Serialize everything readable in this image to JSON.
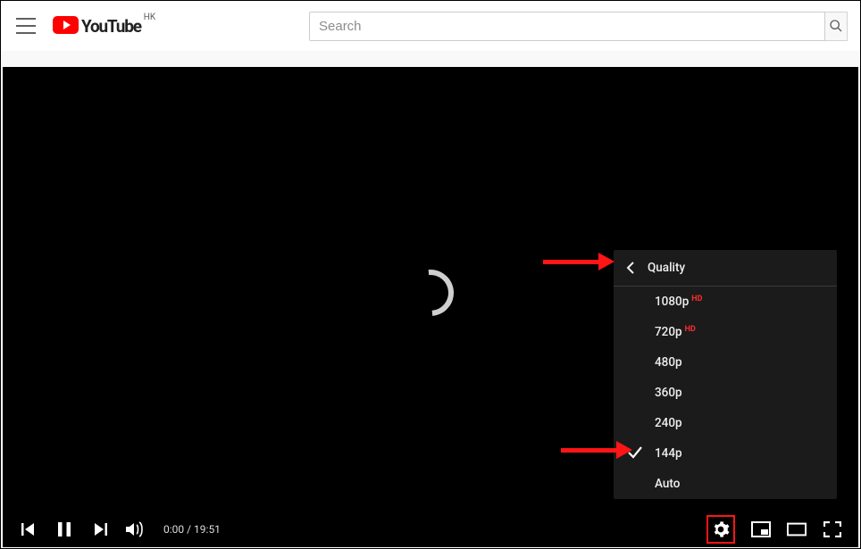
{
  "header": {
    "logo_text": "YouTube",
    "region": "HK",
    "search_placeholder": "Search"
  },
  "player": {
    "time_current": "0:00",
    "time_separator": " / ",
    "time_duration": "19:51"
  },
  "quality_menu": {
    "title": "Quality",
    "selected_index": 5,
    "options": [
      {
        "label": "1080p",
        "hd": "HD"
      },
      {
        "label": "720p",
        "hd": "HD"
      },
      {
        "label": "480p",
        "hd": ""
      },
      {
        "label": "360p",
        "hd": ""
      },
      {
        "label": "240p",
        "hd": ""
      },
      {
        "label": "144p",
        "hd": ""
      },
      {
        "label": "Auto",
        "hd": ""
      }
    ]
  }
}
